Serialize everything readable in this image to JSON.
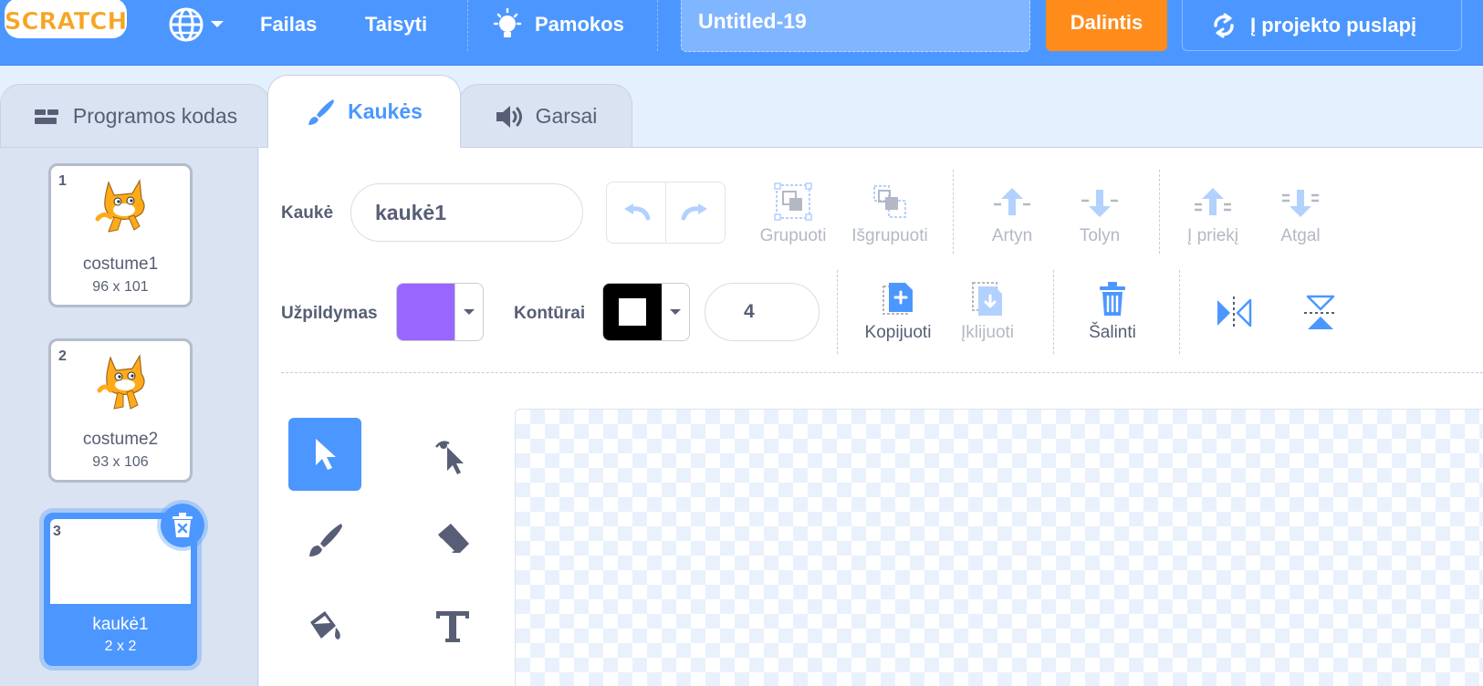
{
  "menubar": {
    "logo_text": "SCRATCH",
    "file_label": "Failas",
    "edit_label": "Taisyti",
    "tutorials_label": "Pamokos",
    "project_title": "Untitled-19",
    "share_label": "Dalintis",
    "see_project_page_label": "Į projekto puslapį"
  },
  "tabs": [
    {
      "label": "Programos kodas",
      "active": false,
      "icon": "code-icon"
    },
    {
      "label": "Kaukės",
      "active": true,
      "icon": "brush-icon"
    },
    {
      "label": "Garsai",
      "active": false,
      "icon": "speaker-icon"
    }
  ],
  "costumes": [
    {
      "number": "1",
      "name": "costume1",
      "size": "96 x 101"
    },
    {
      "number": "2",
      "name": "costume2",
      "size": "93 x 106"
    },
    {
      "number": "3",
      "name": "kaukė1",
      "size": "2 x 2",
      "selected": true
    }
  ],
  "editor": {
    "costume_label": "Kaukė",
    "costume_name": "kaukė1",
    "group_label": "Grupuoti",
    "ungroup_label": "Išgrupuoti",
    "forward_label": "Artyn",
    "backward_label": "Tolyn",
    "front_label": "Į priekį",
    "back_label": "Atgal",
    "fill_label": "Užpildymas",
    "fill_color": "#9966ff",
    "outline_label": "Kontūrai",
    "outline_color": "#000000",
    "outline_width": "4",
    "copy_label": "Kopijuoti",
    "paste_label": "Įklijuoti",
    "delete_label": "Šalinti"
  },
  "colors": {
    "accent": "#4c97ff",
    "share": "#ff8c1a",
    "text": "#575e75"
  }
}
